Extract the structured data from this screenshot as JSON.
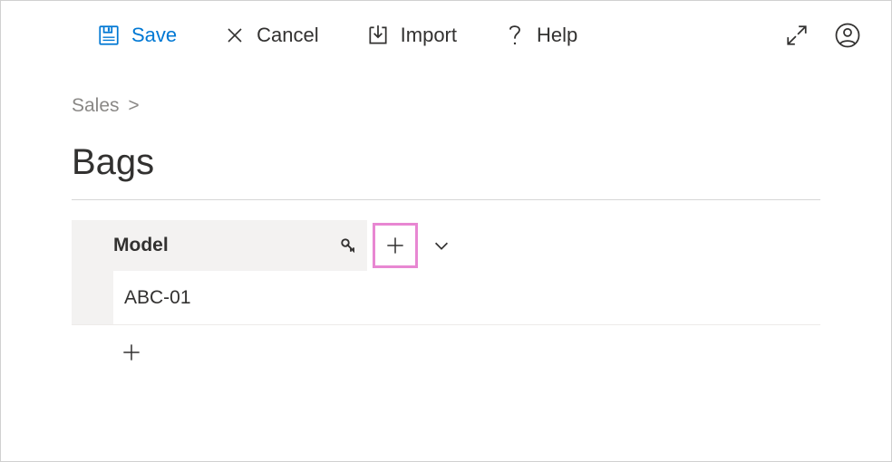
{
  "toolbar": {
    "save_label": "Save",
    "cancel_label": "Cancel",
    "import_label": "Import",
    "help_label": "Help"
  },
  "breadcrumb": {
    "items": [
      "Sales"
    ],
    "separator": ">"
  },
  "page": {
    "title": "Bags"
  },
  "grid": {
    "columns": [
      {
        "label": "Model",
        "is_key": true
      }
    ],
    "rows": [
      {
        "model": "ABC-01"
      }
    ]
  },
  "icons": {
    "save": "save-icon",
    "cancel": "close-icon",
    "import": "import-icon",
    "help": "help-icon",
    "expand": "expand-icon",
    "account": "account-icon",
    "key": "key-icon",
    "plus": "plus-icon",
    "chevron_down": "chevron-down-icon"
  }
}
